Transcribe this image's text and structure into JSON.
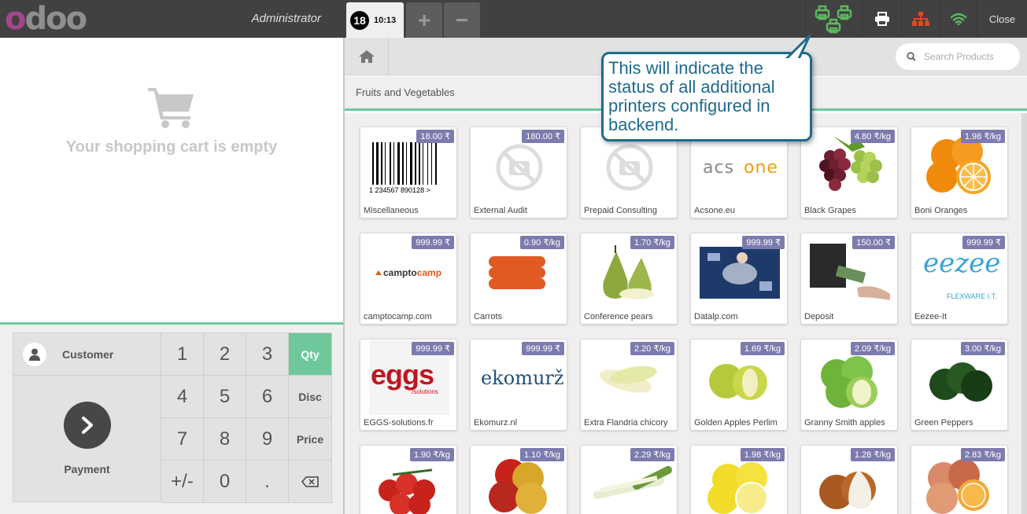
{
  "header": {
    "logo_text": "odoo",
    "user": "Administrator",
    "order_number": "18",
    "order_time": "10:13",
    "add_order_label": "+",
    "remove_order_label": "−",
    "close_label": "Close",
    "status_color": "#5cb85c",
    "sync_color": "#e04a21"
  },
  "cart": {
    "empty_text": "Your shopping cart is empty"
  },
  "actionpad": {
    "customer_label": "Customer",
    "payment_label": "Payment"
  },
  "numpad": {
    "keys": [
      "1",
      "2",
      "3",
      "Qty",
      "4",
      "5",
      "6",
      "Disc",
      "7",
      "8",
      "9",
      "Price",
      "+/-",
      "0",
      ".",
      "⌫"
    ],
    "selected_mode": "Qty"
  },
  "products_header": {
    "search_placeholder": "Search Products",
    "category": "Fruits and Vegetables"
  },
  "callout": {
    "text": "This will indicate the status of all additional printers configured in backend."
  },
  "products": [
    {
      "name": "Miscellaneous",
      "price": "18.00 ₹",
      "icon": "barcode"
    },
    {
      "name": "External Audit",
      "price": "180.00 ₹",
      "icon": "no-image"
    },
    {
      "name": "Prepaid Consulting",
      "price": "",
      "icon": "no-image"
    },
    {
      "name": "Acsone.eu",
      "price": "",
      "icon": "acsone-logo"
    },
    {
      "name": "Black Grapes",
      "price": "4.80 ₹/kg",
      "icon": "grapes"
    },
    {
      "name": "Boni Oranges",
      "price": "1.98 ₹/kg",
      "icon": "oranges"
    },
    {
      "name": "camptocamp.com",
      "price": "999.99 ₹",
      "icon": "camptocamp-logo"
    },
    {
      "name": "Carrots",
      "price": "0.90 ₹/kg",
      "icon": "carrots"
    },
    {
      "name": "Conference pears",
      "price": "1.70 ₹/kg",
      "icon": "pears"
    },
    {
      "name": "Datalp.com",
      "price": "999.99 ₹",
      "icon": "datalp-image"
    },
    {
      "name": "Deposit",
      "price": "150.00 ₹",
      "icon": "deposit-image"
    },
    {
      "name": "Eezee-It",
      "price": "999.99 ₹",
      "icon": "eezee-logo"
    },
    {
      "name": "EGGS-solutions.fr",
      "price": "999.99 ₹",
      "icon": "eggs-logo"
    },
    {
      "name": "Ekomurz.nl",
      "price": "999.99 ₹",
      "icon": "ekomurz-logo"
    },
    {
      "name": "Extra Flandria chicory",
      "price": "2.20 ₹/kg",
      "icon": "chicory"
    },
    {
      "name": "Golden Apples Perlim",
      "price": "1.69 ₹/kg",
      "icon": "golden-apples"
    },
    {
      "name": "Granny Smith apples",
      "price": "2.09 ₹/kg",
      "icon": "green-apples"
    },
    {
      "name": "Green Peppers",
      "price": "3.00 ₹/kg",
      "icon": "green-peppers"
    },
    {
      "name": "",
      "price": "1.90 ₹/kg",
      "icon": "tomatoes"
    },
    {
      "name": "",
      "price": "1.10 ₹/kg",
      "icon": "red-apples"
    },
    {
      "name": "",
      "price": "2.29 ₹/kg",
      "icon": "leeks"
    },
    {
      "name": "",
      "price": "1.98 ₹/kg",
      "icon": "lemons"
    },
    {
      "name": "",
      "price": "1.28 ₹/kg",
      "icon": "onions"
    },
    {
      "name": "",
      "price": "2.83 ₹/kg",
      "icon": "blood-oranges"
    }
  ],
  "product_extra_text": {
    "eezee_sub": "FLEXWARE I.T.",
    "eggs_sub": "/solutions",
    "barcode_digits": "1 234567 890128 >"
  }
}
